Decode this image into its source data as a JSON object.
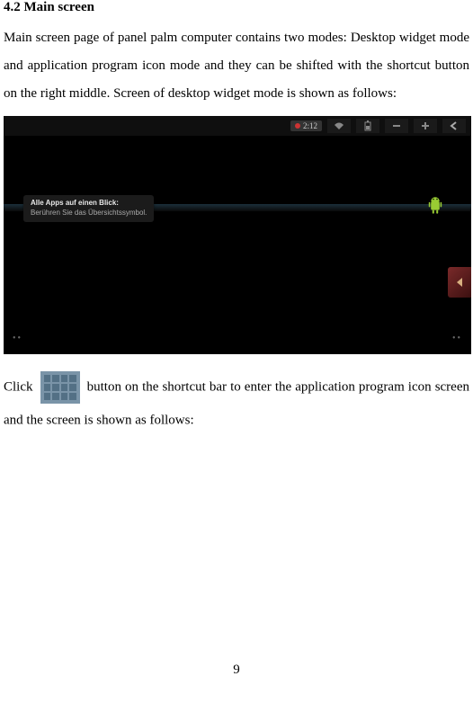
{
  "heading": "4.2 Main screen",
  "para1": "Main screen page of panel palm computer contains two modes: Desktop widget mode and application program icon mode and they can be shifted with the shortcut button on the right middle. Screen of desktop widget mode is shown as follows:",
  "screenshot": {
    "status_time": "2:12",
    "hint_title": "Alle Apps auf einen Blick:",
    "hint_sub": "Berühren Sie das Übersichtssymbol."
  },
  "click_before": "Click ",
  "click_after": " button on the shortcut bar to enter the application program icon screen and the screen is shown as follows:",
  "page_number": "9"
}
